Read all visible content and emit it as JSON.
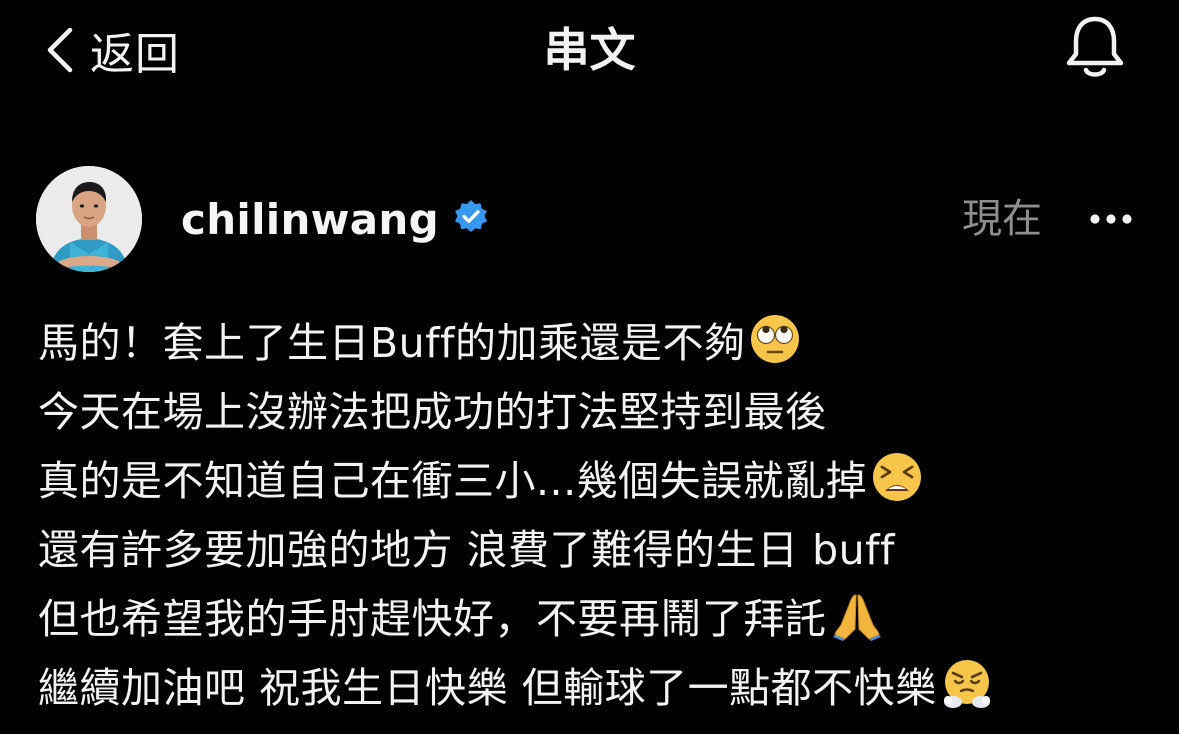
{
  "header": {
    "back_label": "返回",
    "title": "串文"
  },
  "post": {
    "username": "chilinwang",
    "verified": true,
    "timestamp": "現在",
    "lines": [
      {
        "text": "馬的！套上了生日Buff的加乘還是不夠",
        "emoji": "face-with-rolling-eyes"
      },
      {
        "text": "今天在場上沒辦法把成功的打法堅持到最後",
        "emoji": ""
      },
      {
        "text": "真的是不知道自己在衝三小...幾個失誤就亂掉",
        "emoji": "tired-face"
      },
      {
        "text": "還有許多要加強的地方 浪費了難得的生日 buff",
        "emoji": ""
      },
      {
        "text": "但也希望我的手肘趕快好，不要再鬧了拜託",
        "emoji": "folded-hands"
      },
      {
        "text": "繼續加油吧 祝我生日快樂 但輸球了一點都不快樂",
        "emoji": "face-with-steam-from-nose"
      }
    ]
  },
  "colors": {
    "background": "#000000",
    "text": "#f2f2f2",
    "muted": "#8e8e8e",
    "verified_badge": "#3897f0"
  },
  "icons": {
    "back": "chevron-left-icon",
    "bell": "bell-icon",
    "verified": "verified-badge-icon",
    "more": "more-horizontal-icon"
  }
}
